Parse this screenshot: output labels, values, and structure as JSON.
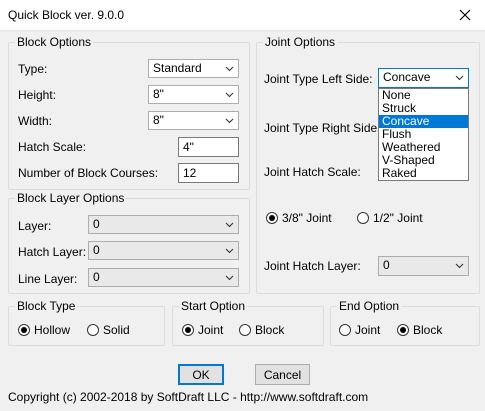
{
  "window": {
    "title": "Quick Block ver. 9.0.0"
  },
  "block_options": {
    "group_label": "Block Options",
    "type_label": "Type:",
    "type_value": "Standard",
    "height_label": "Height:",
    "height_value": "8\"",
    "width_label": "Width:",
    "width_value": "8\"",
    "hatch_scale_label": "Hatch Scale:",
    "hatch_scale_value": "4\"",
    "courses_label": "Number of Block Courses:",
    "courses_value": "12"
  },
  "block_layer_options": {
    "group_label": "Block Layer Options",
    "layer_label": "Layer:",
    "layer_value": "0",
    "hatch_layer_label": "Hatch Layer:",
    "hatch_layer_value": "0",
    "line_layer_label": "Line Layer:",
    "line_layer_value": "0"
  },
  "joint_options": {
    "group_label": "Joint Options",
    "left_side_label": "Joint Type Left Side:",
    "left_side_value": "Concave",
    "left_side_options": [
      "None",
      "Struck",
      "Concave",
      "Flush",
      "Weathered",
      "V-Shaped",
      "Raked"
    ],
    "left_side_selected_index": 2,
    "right_side_label": "Joint Type Right Side:",
    "hatch_scale_label": "Joint Hatch Scale:",
    "joint_size_3_8": "3/8\" Joint",
    "joint_size_1_2": "1/2\" Joint",
    "joint_size_selected": "3/8\" Joint",
    "hatch_layer_label": "Joint Hatch Layer:",
    "hatch_layer_value": "0"
  },
  "block_type": {
    "group_label": "Block Type",
    "hollow": "Hollow",
    "solid": "Solid",
    "selected": "Hollow"
  },
  "start_option": {
    "group_label": "Start Option",
    "joint": "Joint",
    "block": "Block",
    "selected": "Joint"
  },
  "end_option": {
    "group_label": "End Option",
    "joint": "Joint",
    "block": "Block",
    "selected": "Block"
  },
  "buttons": {
    "ok": "OK",
    "cancel": "Cancel"
  },
  "footer": {
    "copyright": "Copyright (c) 2002-2018 by SoftDraft LLC - http://www.softdraft.com"
  },
  "icons": {
    "close": "close-icon",
    "dropdown": "chevron-down-icon"
  },
  "colors": {
    "selection": "#0078d7",
    "dialog_bg": "#f0f0f0"
  }
}
